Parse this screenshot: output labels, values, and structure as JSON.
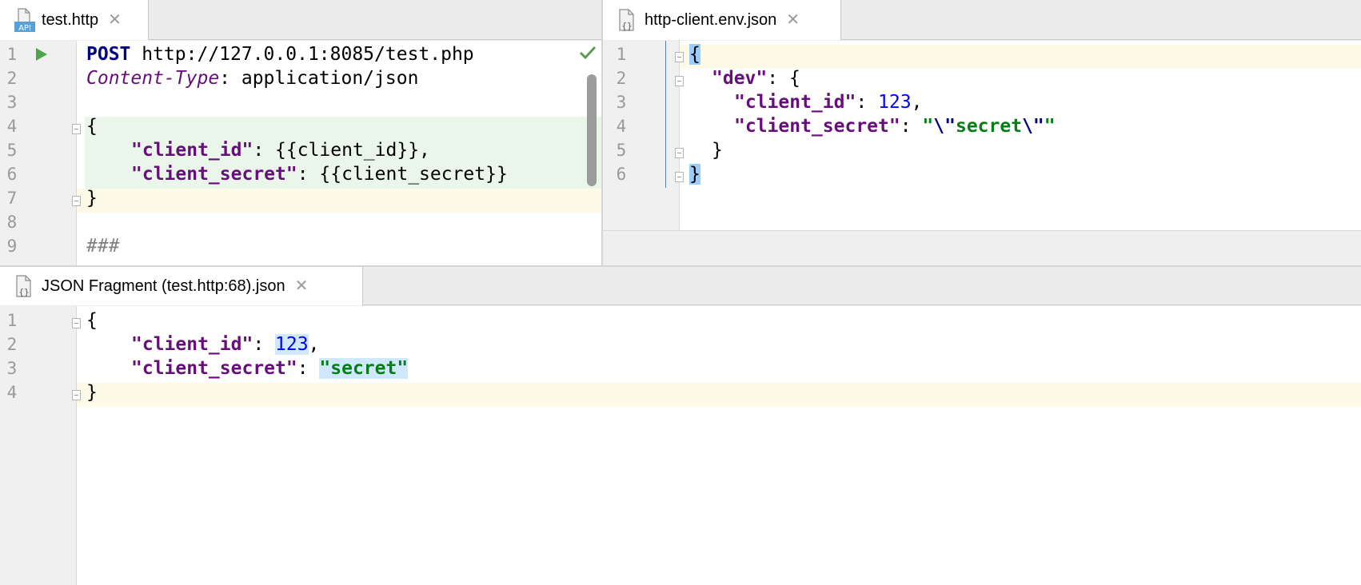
{
  "left_pane": {
    "tab_label": "test.http",
    "tab_icon": "api-file-icon",
    "line_numbers": [
      "1",
      "2",
      "3",
      "4",
      "5",
      "6",
      "7",
      "8",
      "9"
    ],
    "lines": {
      "l1_method": "POST",
      "l1_url": " http://127.0.0.1:8085/test.php",
      "l2_header": "Content-Type",
      "l2_value": ": application/json",
      "l4": "{",
      "l5_key": "\"client_id\"",
      "l5_rest": ": {{client_id}},",
      "l6_key": "\"client_secret\"",
      "l6_rest": ": {{client_secret}}",
      "l7": "}",
      "l9": "###"
    },
    "status_icon": "checkmark-icon",
    "colors": {
      "injection_bg": "#eaf6ea",
      "current_line_bg": "#fdfbe7",
      "check_color": "#5d9b52"
    }
  },
  "right_pane": {
    "tab_label": "http-client.env.json",
    "tab_icon": "json-file-icon",
    "line_numbers": [
      "1",
      "2",
      "3",
      "4",
      "5",
      "6"
    ],
    "lines": {
      "l1": "{",
      "l2_key": "\"dev\"",
      "l2_rest": ": {",
      "l3_key": "\"client_id\"",
      "l3_colon": ": ",
      "l3_num": "123",
      "l3_comma": ",",
      "l4_key": "\"client_secret\"",
      "l4_colon": ": ",
      "l4_q1": "\"",
      "l4_esc1": "\\\"",
      "l4_word": "secret",
      "l4_esc2": "\\\"",
      "l4_q2": "\"",
      "l5": "}",
      "l6": "}"
    }
  },
  "bottom_pane": {
    "tab_label": "JSON Fragment (test.http:68).json",
    "tab_icon": "json-file-icon",
    "line_numbers": [
      "1",
      "2",
      "3",
      "4"
    ],
    "lines": {
      "l1": "{",
      "l2_key": "\"client_id\"",
      "l2_colon": ": ",
      "l2_num": "123",
      "l2_comma": ",",
      "l3_key": "\"client_secret\"",
      "l3_colon": ": ",
      "l3_str": "\"secret\"",
      "l4": "}"
    }
  },
  "close_glyph": "✕"
}
